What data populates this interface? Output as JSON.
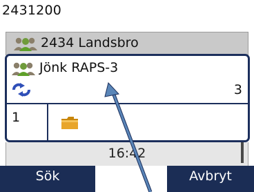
{
  "header": {
    "number": "2431200"
  },
  "groups": [
    {
      "label": "2434 Landsbro"
    }
  ],
  "selected": {
    "name": "Jönk RAPS-3",
    "count": "3",
    "slot": "1"
  },
  "status": {
    "time": "16:42"
  },
  "softkeys": {
    "left": "Sök",
    "right": "Avbryt"
  },
  "icons": {
    "group": "group-users-icon",
    "loop": "refresh-loop-icon",
    "folder": "folder-icon",
    "pointer": "pointer-arrow-icon"
  },
  "colors": {
    "accent": "#1b2d55",
    "selection_border": "#1c2f5c",
    "arrow": "#5a86b8"
  }
}
